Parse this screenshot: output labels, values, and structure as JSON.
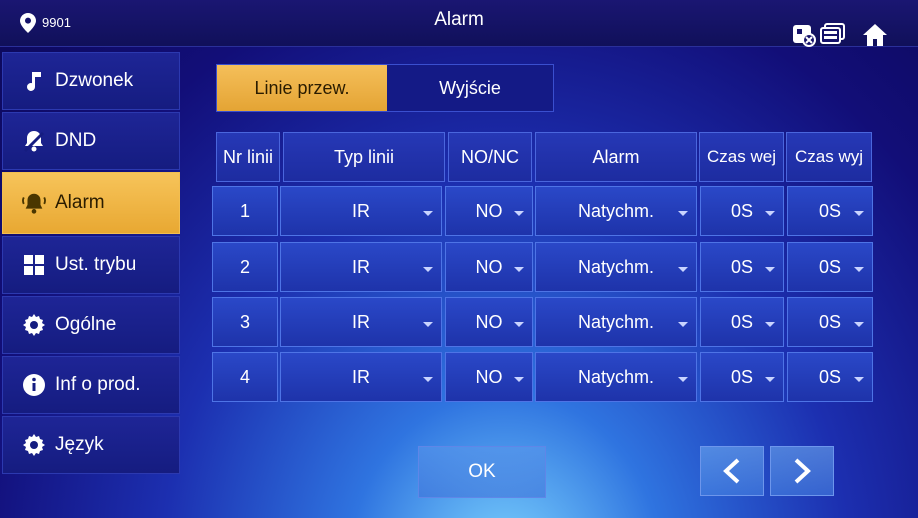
{
  "header": {
    "location": "9901",
    "title": "Alarm"
  },
  "sidebar": {
    "items": [
      {
        "label": "Dzwonek",
        "icon": "music-note-icon",
        "active": false
      },
      {
        "label": "DND",
        "icon": "bell-off-icon",
        "active": false
      },
      {
        "label": "Alarm",
        "icon": "alarm-bell-icon",
        "active": true
      },
      {
        "label": "Ust. trybu",
        "icon": "grid-icon",
        "active": false
      },
      {
        "label": "Ogólne",
        "icon": "gear-icon",
        "active": false
      },
      {
        "label": "Inf o prod.",
        "icon": "info-icon",
        "active": false
      },
      {
        "label": "Język",
        "icon": "gear-icon",
        "active": false
      }
    ]
  },
  "tabs": {
    "active": "Linie przew.",
    "inactive": "Wyjście"
  },
  "table": {
    "headers": [
      "Nr linii",
      "Typ linii",
      "NO/NC",
      "Alarm",
      "Czas wej",
      "Czas wyj"
    ],
    "rows": [
      [
        "1",
        "IR",
        "NO",
        "Natychm.",
        "0S",
        "0S"
      ],
      [
        "2",
        "IR",
        "NO",
        "Natychm.",
        "0S",
        "0S"
      ],
      [
        "3",
        "IR",
        "NO",
        "Natychm.",
        "0S",
        "0S"
      ],
      [
        "4",
        "IR",
        "NO",
        "Natychm.",
        "0S",
        "0S"
      ]
    ]
  },
  "buttons": {
    "ok": "OK"
  },
  "colors": {
    "accent": "#f2b544",
    "background": "#120e78"
  }
}
